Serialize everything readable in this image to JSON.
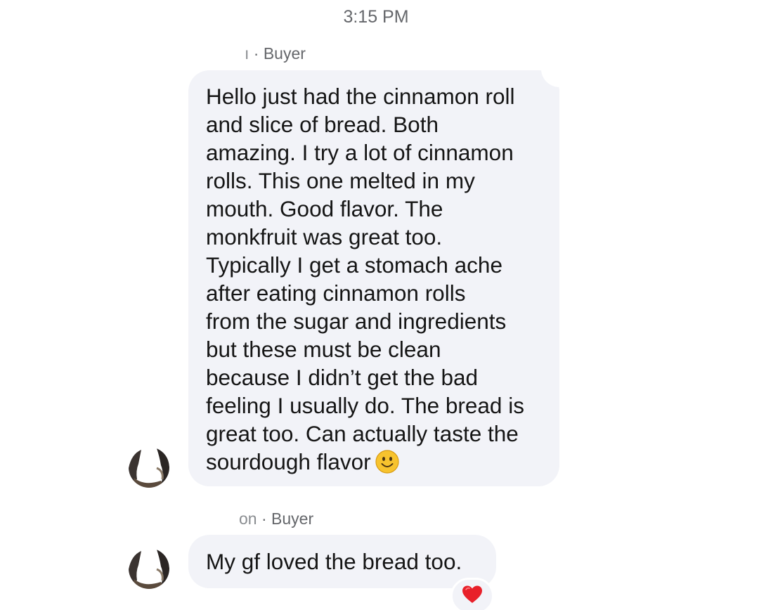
{
  "timestamp": "3:15 PM",
  "messages": [
    {
      "sender_name": "ı",
      "sender_role": "· Buyer",
      "text": "Hello just had the cinnamon roll\nand slice of bread. Both\namazing. I try a lot of cinnamon\nrolls. This one melted in my\nmouth. Good flavor. The\nmonkfruit was great too.\nTypically I get a stomach ache\nafter eating cinnamon rolls\nfrom the sugar and ingredients\nbut these must be clean\nbecause I didn’t get the bad\nfeeling I usually do. The bread is\ngreat too. Can actually taste the\nsourdough flavor",
      "emoji": "slightly-smiling-face-icon"
    },
    {
      "sender_name": "on",
      "sender_role": "· Buyer",
      "text": "My gf loved the bread too.",
      "reaction": "red-heart-icon"
    }
  ],
  "colors": {
    "bubble_bg": "#f2f3f8",
    "secondary_text": "#65676b",
    "heart": "#e8202a"
  }
}
